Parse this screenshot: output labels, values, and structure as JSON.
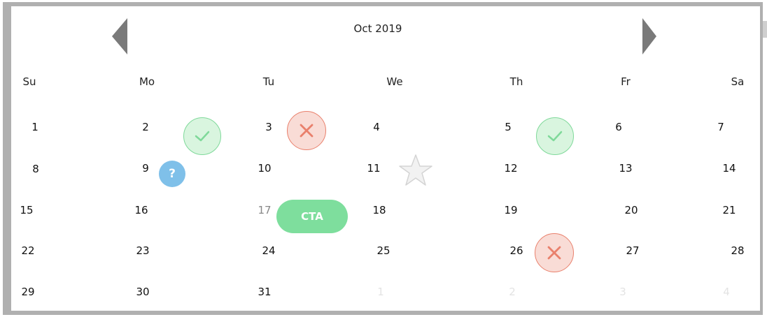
{
  "calendar": {
    "month_label": "Oct 2019",
    "weekdays": [
      "Su",
      "Mo",
      "Tu",
      "We",
      "Th",
      "Fr",
      "Sa"
    ],
    "weeks": [
      [
        "1",
        "2",
        "3",
        "4",
        "5",
        "6",
        "7"
      ],
      [
        "8",
        "9",
        "10",
        "11",
        "12",
        "13",
        "14"
      ],
      [
        "15",
        "16",
        "17",
        "18",
        "19",
        "20",
        "21"
      ],
      [
        "22",
        "23",
        "24",
        "25",
        "26",
        "27",
        "28"
      ],
      [
        "29",
        "30",
        "31",
        "1",
        "2",
        "3",
        "4"
      ]
    ]
  },
  "badges": {
    "help_glyph": "?",
    "cta_label": "CTA"
  },
  "colors": {
    "frame": "#b0b0b0",
    "ok_fill": "#d9f5df",
    "ok_stroke": "#7fd99a",
    "no_fill": "#f9dcd6",
    "no_stroke": "#e9806c",
    "help": "#7fc0e9",
    "cta": "#7ede9d",
    "arrow": "#7a7a7a"
  },
  "icons": {
    "prev": "chevron-left-icon",
    "next": "chevron-right-icon",
    "ok": "check-icon",
    "no": "close-icon",
    "help": "question-icon",
    "favorite": "star-icon"
  }
}
